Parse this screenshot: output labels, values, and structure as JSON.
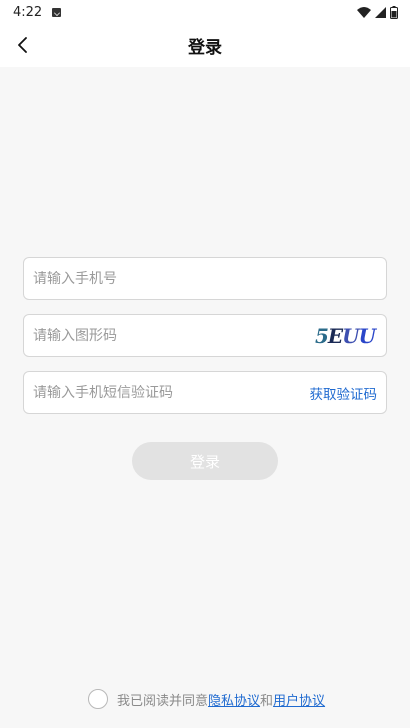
{
  "status_bar": {
    "time": "4:22",
    "icons": [
      "notification-a-icon",
      "wifi-icon",
      "signal-icon",
      "battery-icon"
    ]
  },
  "header": {
    "title": "登录",
    "back_icon": "back-arrow-icon"
  },
  "form": {
    "phone_placeholder": "请输入手机号",
    "captcha_placeholder": "请输入图形码",
    "captcha_text": [
      "5",
      "E",
      "U",
      "U"
    ],
    "sms_placeholder": "请输入手机短信验证码",
    "get_code_label": "获取验证码",
    "login_label": "登录"
  },
  "agreement": {
    "prefix": "我已阅读并同意",
    "privacy_link": "隐私协议",
    "conjunction": "和",
    "user_link": "用户协议"
  },
  "colors": {
    "accent": "#1f6ad0",
    "disabled_button": "#e2e2e2",
    "background": "#f7f7f7"
  }
}
